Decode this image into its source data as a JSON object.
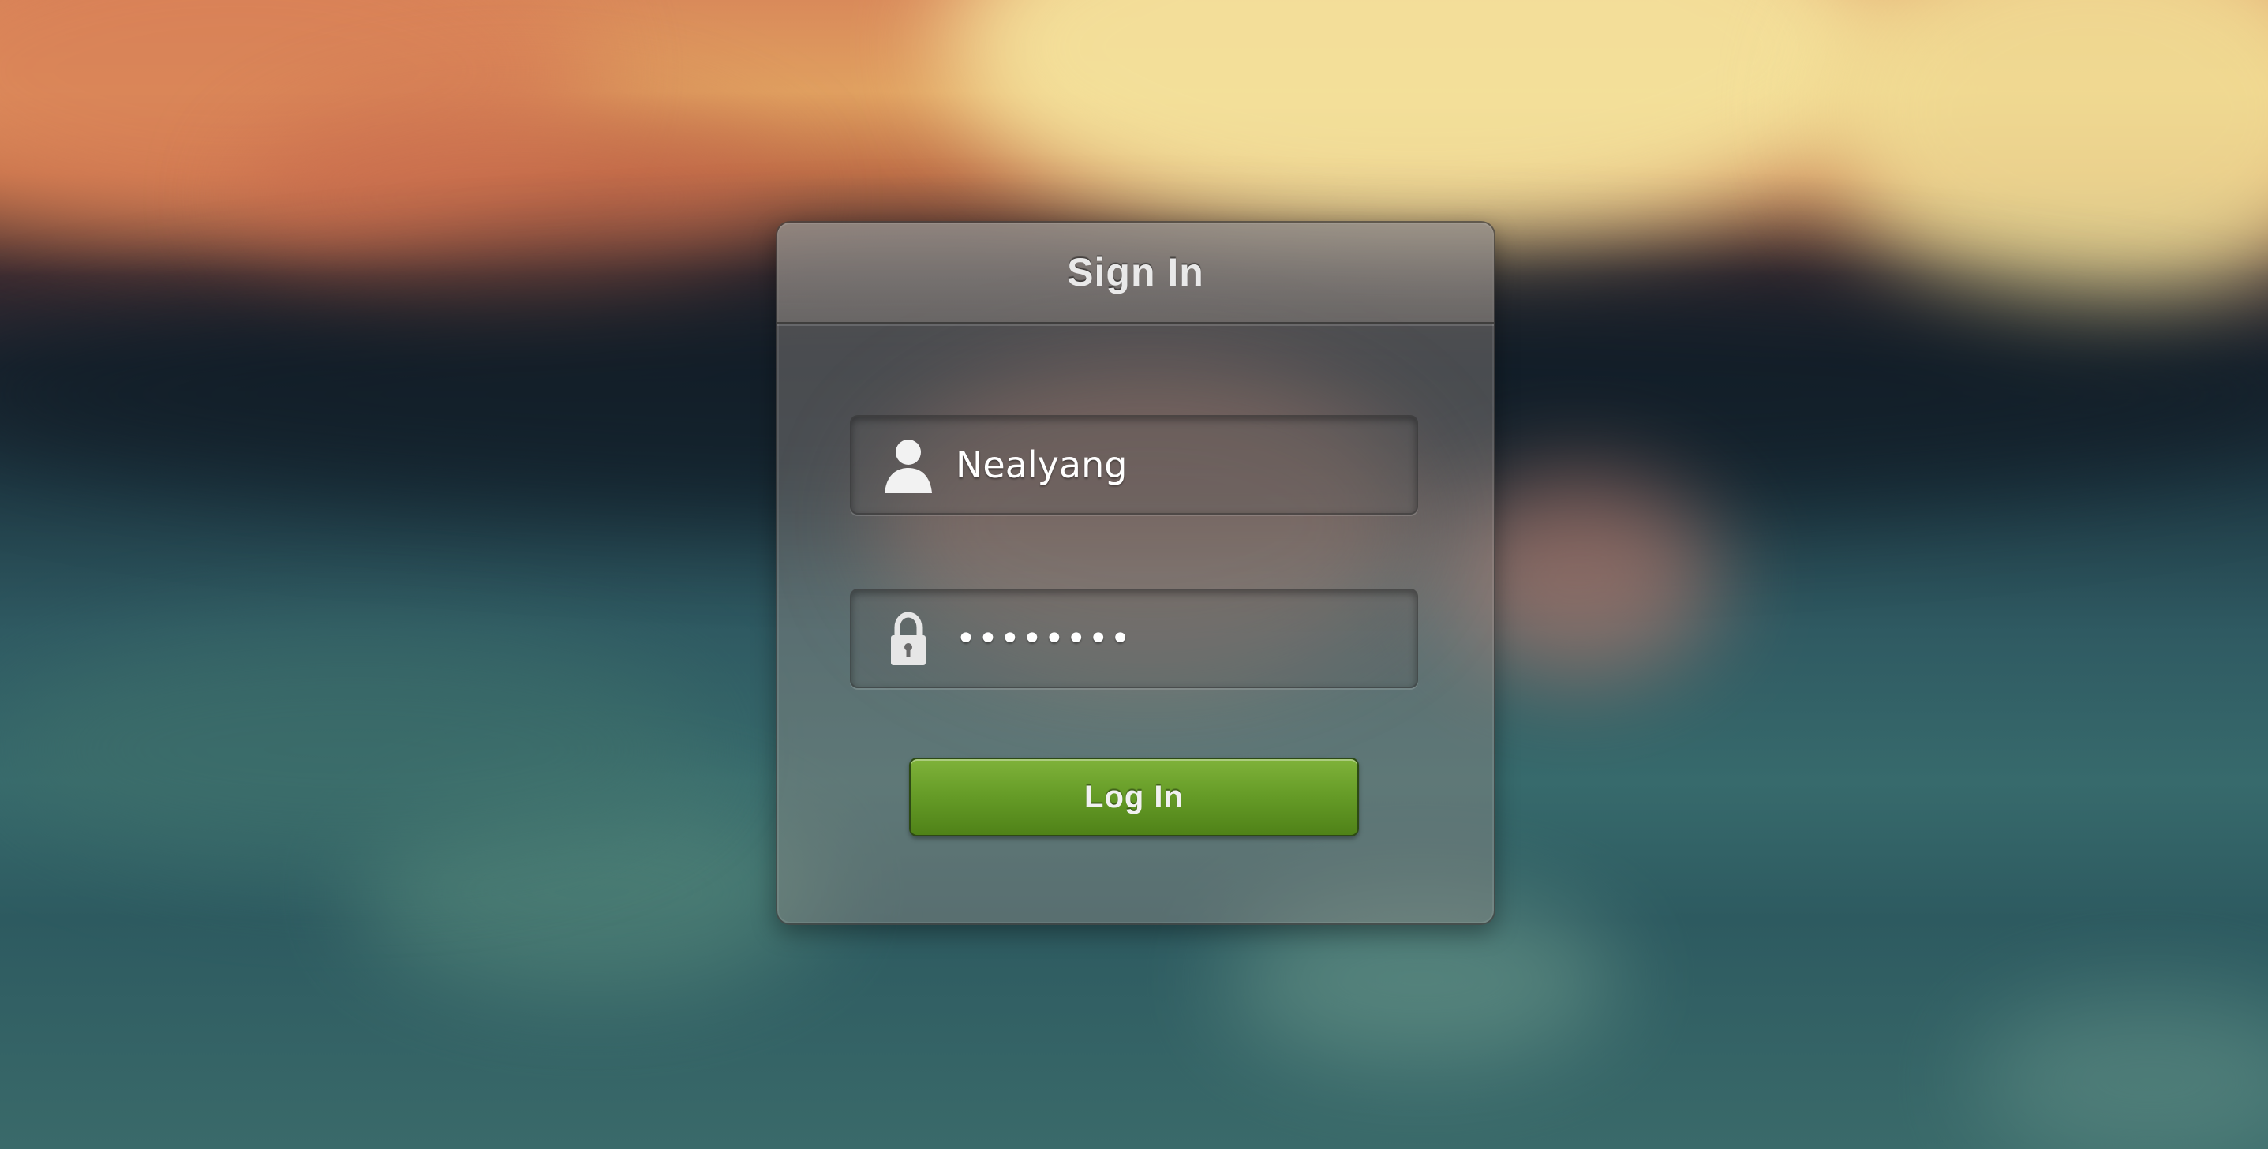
{
  "dialog": {
    "title": "Sign In"
  },
  "username_field": {
    "icon": "user-icon",
    "value": "Nealyang"
  },
  "password_field": {
    "icon": "lock-icon",
    "value": "••••••••"
  },
  "login_button": {
    "label": "Log In"
  },
  "colors": {
    "button_green": "#679d28",
    "text_white": "#ffffff"
  }
}
